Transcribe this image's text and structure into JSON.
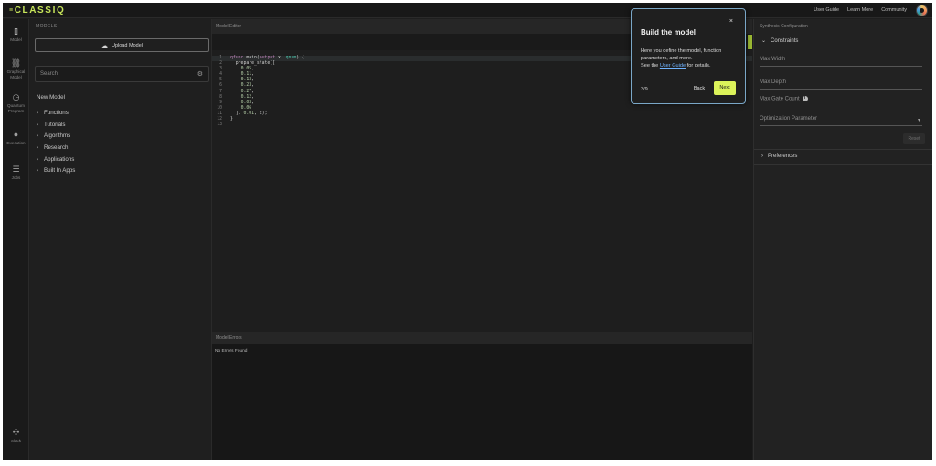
{
  "header": {
    "logo": "CLASSIQ",
    "nav": [
      "User Guide",
      "Learn More",
      "Community"
    ]
  },
  "iconbar": [
    {
      "label": "Model",
      "icon": "model-icon",
      "glyph": "▯"
    },
    {
      "label": "Graphical\nModel",
      "icon": "graph-icon",
      "glyph": "⛓"
    },
    {
      "label": "Quantum\nProgram",
      "icon": "clock-icon",
      "glyph": "◷"
    },
    {
      "label": "Execution",
      "icon": "execution-icon",
      "glyph": "●"
    },
    {
      "label": "Jobs",
      "icon": "jobs-icon",
      "glyph": "☰"
    },
    {
      "label": "Slack",
      "icon": "slack-icon",
      "glyph": "✣"
    }
  ],
  "models": {
    "title": "MODELS",
    "upload_label": "Upload Model",
    "search_placeholder": "Search",
    "new_model": "New Model",
    "folders": [
      "Functions",
      "Tutorials",
      "Algorithms",
      "Research",
      "Applications",
      "Built In Apps"
    ]
  },
  "editor": {
    "title": "Model Editor",
    "code": [
      "qfunc main(output x: qnum) {",
      "  prepare_state([",
      "    0.05,",
      "    0.11,",
      "    0.13,",
      "    0.23,",
      "    0.27,",
      "    0.12,",
      "    0.03,",
      "    0.06",
      "  ], 0.01, x);",
      "}",
      ""
    ],
    "errors_title": "Model Errors",
    "errors_text": "No Errors Found"
  },
  "synth": {
    "title": "Synthesis Configuration",
    "constraints_label": "Constraints",
    "max_width": "Max Width",
    "max_depth": "Max Depth",
    "max_gate_count": "Max Gate Count",
    "optimization": "Optimization Parameter",
    "reset": "Reset",
    "preferences": "Preferences"
  },
  "tour": {
    "title": "Build the model",
    "body1": "Here you define the model, function parameters, and more.",
    "body2_pre": "See the ",
    "body2_link": "User Guide",
    "body2_post": " for details.",
    "step": "3/9",
    "back": "Back",
    "next": "Next"
  },
  "colors": {
    "accent": "#dcf35a",
    "brand": "#c7e55a",
    "link": "#6fb3ff"
  }
}
